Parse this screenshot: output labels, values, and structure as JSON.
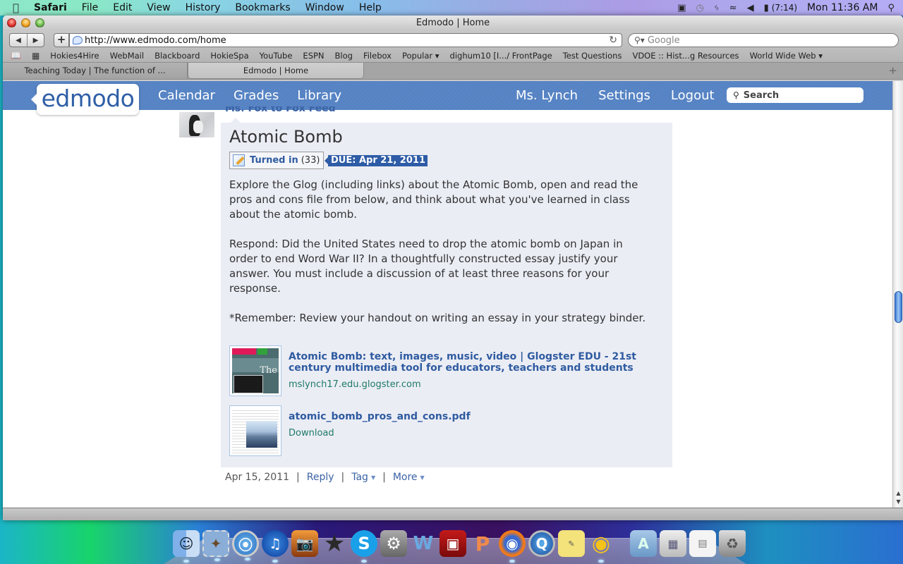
{
  "menubar": {
    "app_name": "Safari",
    "items": [
      "File",
      "Edit",
      "View",
      "History",
      "Bookmarks",
      "Window",
      "Help"
    ],
    "battery_time": "(7:14)",
    "clock": "Mon 11:36 AM"
  },
  "window": {
    "title": "Edmodo | Home",
    "url": "http://www.edmodo.com/home",
    "search_placeholder": "Google",
    "bookmarks": [
      "Hokies4Hire",
      "WebMail",
      "Blackboard",
      "HokieSpa",
      "YouTube",
      "ESPN",
      "Blog",
      "Filebox",
      "Popular ▾",
      "dighum10 [I.../ FrontPage",
      "Test Questions",
      "VDOE :: Hist...g Resources",
      "World Wide Web ▾"
    ],
    "tabs": [
      {
        "label": "Teaching Today | The function of ...",
        "active": false
      },
      {
        "label": "Edmodo | Home",
        "active": true
      }
    ]
  },
  "edmodo": {
    "logo": "edmodo",
    "nav_left": [
      "Calendar",
      "Grades",
      "Library"
    ],
    "nav_right": [
      "Ms. Lynch",
      "Settings",
      "Logout"
    ],
    "search_placeholder": "Search",
    "from_line": "Ms. Fox to Fox Feed",
    "post": {
      "title": "Atomic Bomb",
      "turned_in_label": "Turned in",
      "turned_in_count": "(33)",
      "due": "DUE: Apr 21, 2011",
      "paragraphs": [
        "Explore the Glog (including links) about the Atomic Bomb, open and read the pros and cons file from below, and think about what you've learned in class about the atomic bomb.",
        "Respond: Did the United States need to drop the atomic bomb on Japan in order to end Word War II? In a thoughtfully constructed essay justify your answer. You must include a discussion of at least three reasons for your response.",
        "*Remember: Review your handout on writing an essay in your strategy binder."
      ],
      "attachments": [
        {
          "title": "Atomic Bomb: text, images, music, video | Glogster EDU - 21st century multimedia tool for educators, teachers and students",
          "subtitle": "mslynch17.edu.glogster.com",
          "thumb_text": "The"
        },
        {
          "title": "atomic_bomb_pros_and_cons.pdf",
          "subtitle": "Download"
        }
      ],
      "date": "Apr 15, 2011",
      "actions": [
        "Reply",
        "Tag",
        "More"
      ]
    }
  },
  "dock": [
    "Finder",
    "Mail",
    "Safari",
    "iTunes",
    "iPhoto",
    "iMovie",
    "Skype",
    "System Preferences",
    "Word",
    "Photo Booth",
    "PowerPoint",
    "Firefox",
    "QuickTime",
    "Stickies",
    "Cyberduck",
    "Applications",
    "Preview",
    "Documents",
    "Trash"
  ]
}
